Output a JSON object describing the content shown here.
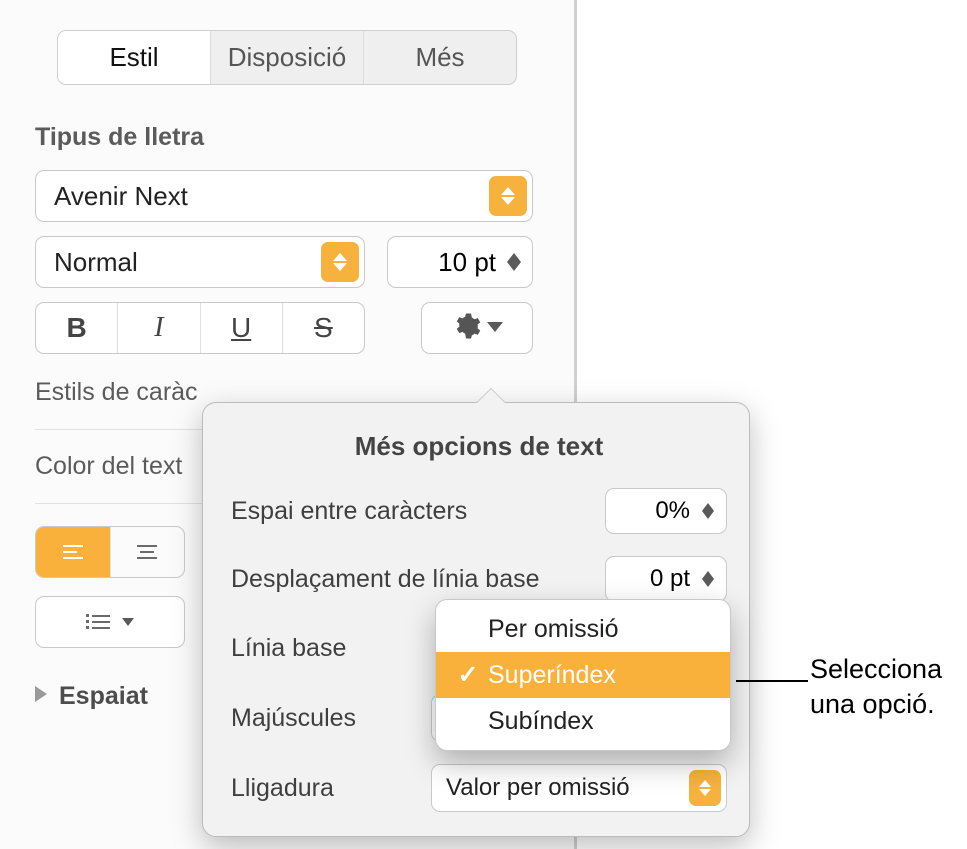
{
  "tabs": {
    "style": "Estil",
    "layout": "Disposició",
    "more": "Més"
  },
  "font_section_title": "Tipus de lletra",
  "font_family": "Avenir Next",
  "font_weight": "Normal",
  "font_size": "10 pt",
  "char_styles_label": "Estils de caràc",
  "text_color_label": "Color del text",
  "spacing_label": "Espaiat",
  "popover": {
    "title": "Més opcions de text",
    "char_spacing_label": "Espai entre caràcters",
    "char_spacing_value": "0%",
    "baseline_shift_label": "Desplaçament de línia base",
    "baseline_shift_value": "0 pt",
    "baseline_label": "Línia base",
    "caps_label": "Majúscules",
    "ligature_label": "Lligadura",
    "ligature_value": "Valor per omissió"
  },
  "baseline_menu": {
    "default": "Per omissió",
    "superscript": "Superíndex",
    "subscript": "Subíndex"
  },
  "callout": {
    "line1": "Selecciona",
    "line2": "una opció."
  }
}
